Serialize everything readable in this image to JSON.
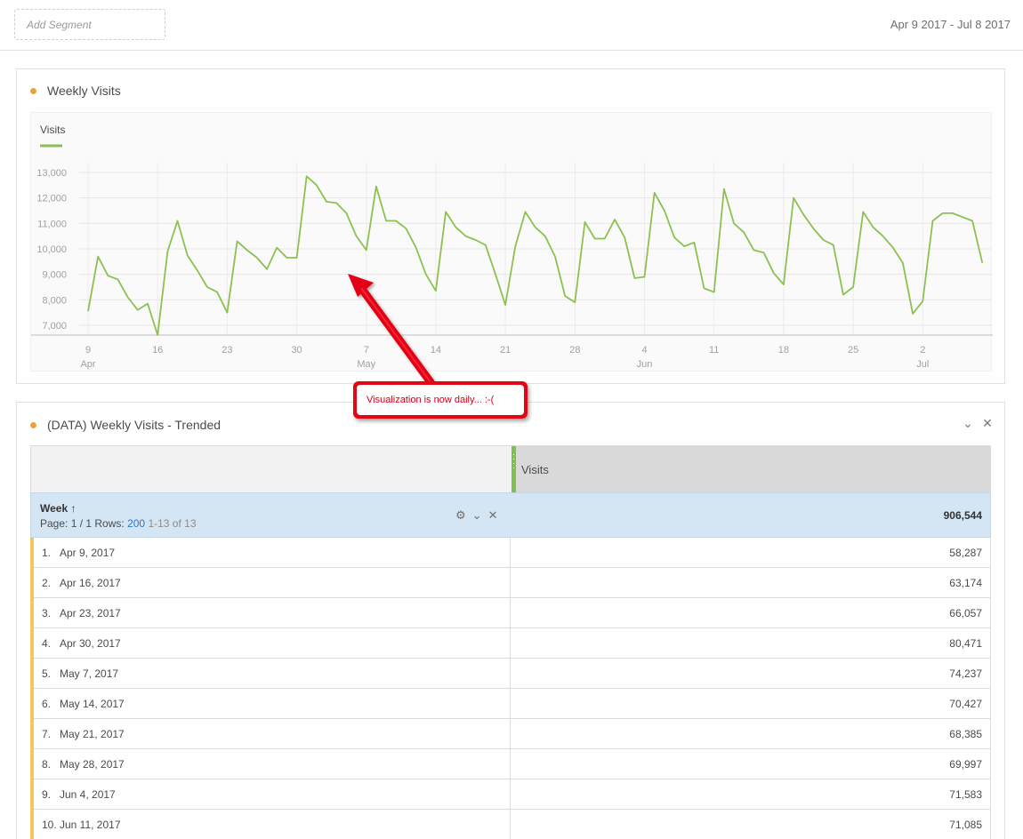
{
  "topbar": {
    "segment_placeholder": "Add Segment",
    "date_range": "Apr 9 2017 - Jul 8 2017"
  },
  "chart_panel": {
    "title": "Weekly Visits",
    "dot_color": "#e8a33d"
  },
  "chart_data": {
    "type": "line",
    "legend": "Visits",
    "series_color": "#8cc152",
    "ylim": [
      7000,
      13000
    ],
    "y_ticks": [
      "13,000",
      "12,000",
      "11,000",
      "10,000",
      "9,000",
      "8,000",
      "7,000"
    ],
    "y_tick_values": [
      13000,
      12000,
      11000,
      10000,
      9000,
      8000,
      7000
    ],
    "x_ticks": [
      {
        "day": "9",
        "month": "Apr",
        "index": 0
      },
      {
        "day": "16",
        "month": "",
        "index": 7
      },
      {
        "day": "23",
        "month": "",
        "index": 14
      },
      {
        "day": "30",
        "month": "",
        "index": 21
      },
      {
        "day": "7",
        "month": "May",
        "index": 28
      },
      {
        "day": "14",
        "month": "",
        "index": 35
      },
      {
        "day": "21",
        "month": "",
        "index": 42
      },
      {
        "day": "28",
        "month": "",
        "index": 49
      },
      {
        "day": "4",
        "month": "Jun",
        "index": 56
      },
      {
        "day": "11",
        "month": "",
        "index": 63
      },
      {
        "day": "18",
        "month": "",
        "index": 70
      },
      {
        "day": "25",
        "month": "",
        "index": 77
      },
      {
        "day": "2",
        "month": "Jul",
        "index": 84
      }
    ],
    "values": [
      7550,
      9700,
      8950,
      8800,
      8100,
      7600,
      7850,
      6500,
      9900,
      11100,
      9750,
      9150,
      8500,
      8300,
      7500,
      10300,
      9950,
      9650,
      9200,
      10050,
      9650,
      9650,
      12850,
      12500,
      11850,
      11800,
      11400,
      10500,
      9950,
      12450,
      11100,
      11100,
      10800,
      10050,
      9000,
      8350,
      11450,
      10850,
      10500,
      10350,
      10150,
      9000,
      7800,
      10100,
      11450,
      10850,
      10500,
      9700,
      8150,
      7900,
      11050,
      10400,
      10400,
      11150,
      10450,
      8850,
      8900,
      12200,
      11500,
      10450,
      10100,
      10250,
      8450,
      8300,
      12350,
      11000,
      10650,
      9950,
      9850,
      9050,
      8600,
      12000,
      11350,
      10800,
      10350,
      10150,
      8200,
      8500,
      11450,
      10850,
      10500,
      10050,
      9450,
      7450,
      7950,
      11100,
      11400,
      11400,
      11250,
      11100,
      9450
    ]
  },
  "table_panel": {
    "title": "(DATA) Weekly Visits - Trended",
    "metric_label": "Visits",
    "dimension_title": "Week",
    "sort_arrow": "↑",
    "page_label": "Page: 1 / 1",
    "rows_label": "Rows:",
    "rows_value": "200",
    "rows_range": "1-13 of 13",
    "total": "906,544",
    "tools": {
      "gear": "⚙",
      "chevron": "⌄",
      "close": "✕"
    },
    "controls": {
      "chevron": "⌄",
      "close": "✕"
    },
    "rows": [
      {
        "num": "1.",
        "label": "Apr 9, 2017",
        "value": "58,287"
      },
      {
        "num": "2.",
        "label": "Apr 16, 2017",
        "value": "63,174"
      },
      {
        "num": "3.",
        "label": "Apr 23, 2017",
        "value": "66,057"
      },
      {
        "num": "4.",
        "label": "Apr 30, 2017",
        "value": "80,471"
      },
      {
        "num": "5.",
        "label": "May 7, 2017",
        "value": "74,237"
      },
      {
        "num": "6.",
        "label": "May 14, 2017",
        "value": "70,427"
      },
      {
        "num": "7.",
        "label": "May 21, 2017",
        "value": "68,385"
      },
      {
        "num": "8.",
        "label": "May 28, 2017",
        "value": "69,997"
      },
      {
        "num": "9.",
        "label": "Jun 4, 2017",
        "value": "71,583"
      },
      {
        "num": "10.",
        "label": "Jun 11, 2017",
        "value": "71,085"
      }
    ]
  },
  "annotation": {
    "text": "Visualization is now daily...  :-(",
    "color": "#e30613"
  }
}
